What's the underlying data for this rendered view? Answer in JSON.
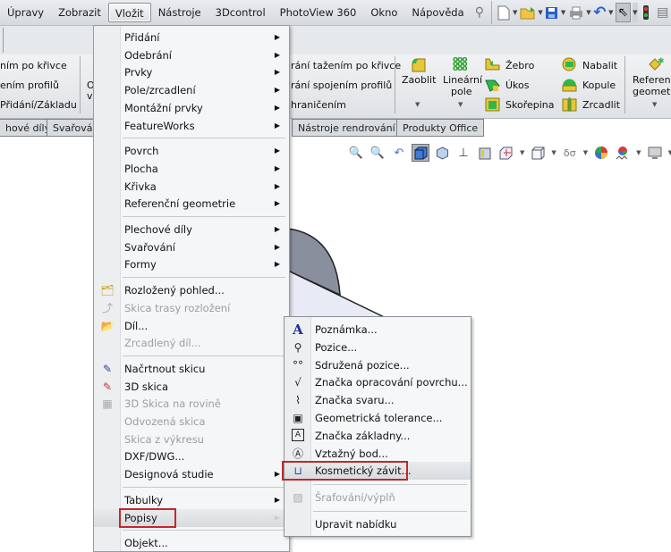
{
  "menubar": {
    "items": [
      "Úpravy",
      "Zobrazit",
      "Vložit",
      "Nástroje",
      "3Dcontrol",
      "PhotoView 360",
      "Okno",
      "Nápověda"
    ],
    "active": "Vložit",
    "toolbar_icons": [
      "pin-icon",
      "new-document-icon",
      "open-folder-icon",
      "save-icon",
      "print-icon",
      "undo-icon",
      "select-pointer-icon",
      "traffic-light-icon"
    ]
  },
  "ribbon": {
    "left_items": [
      "ním po křivce",
      "ením profilů",
      "Přidání/Základu"
    ],
    "left_partial": [
      "O",
      "v"
    ],
    "mid_items": [
      "rání tažením po křivce",
      "rání spojením profilů",
      "hraničením"
    ],
    "features": {
      "fillet": "Zaoblit",
      "linear_pattern_line1": "Lineární",
      "linear_pattern_line2": "pole",
      "rib": "Žebro",
      "draft": "Úkos",
      "shell": "Skořepina",
      "wrap": "Nabalit",
      "dome": "Kopule",
      "mirror": "Zrcadlit",
      "ref_geom_line1": "Referenč",
      "ref_geom_line2": "geometr"
    }
  },
  "tabs": [
    "hové díly",
    "Svařová",
    "Nástroje rendrování",
    "Produkty Office"
  ],
  "view_toolbar_icons": [
    "zoom-to-fit-icon",
    "zoom-area-icon",
    "previous-view-icon",
    "display-style-icon",
    "section-view-icon",
    "view-orientation-icon",
    "hide-show-icon",
    "section-icon",
    "view-cube-icon",
    "glasses-icon",
    "appearance-icon",
    "scene-icon",
    "monitor-icon"
  ],
  "insert_menu": {
    "groups": [
      [
        {
          "label": "Přidání",
          "submenu": true
        },
        {
          "label": "Odebrání",
          "submenu": true
        },
        {
          "label": "Prvky",
          "submenu": true
        },
        {
          "label": "Pole/zrcadlení",
          "submenu": true
        },
        {
          "label": "Montážní prvky",
          "submenu": true
        },
        {
          "label": "FeatureWorks",
          "submenu": true
        }
      ],
      [
        {
          "label": "Povrch",
          "submenu": true
        },
        {
          "label": "Plocha",
          "submenu": true
        },
        {
          "label": "Křivka",
          "submenu": true
        },
        {
          "label": "Referenční geometrie",
          "submenu": true
        }
      ],
      [
        {
          "label": "Plechové díly",
          "submenu": true
        },
        {
          "label": "Svařování",
          "submenu": true
        },
        {
          "label": "Formy",
          "submenu": true
        }
      ],
      [
        {
          "label": "Rozložený pohled...",
          "icon": "exploded-view-icon"
        },
        {
          "label": "Skica trasy rozložení",
          "disabled": true,
          "icon": "explode-line-sketch-icon"
        },
        {
          "label": "Díl...",
          "icon": "part-icon"
        },
        {
          "label": "Zrcadlený díl...",
          "disabled": true
        }
      ],
      [
        {
          "label": "Načrtnout skicu",
          "icon": "sketch-icon"
        },
        {
          "label": "3D skica",
          "icon": "3d-sketch-icon"
        },
        {
          "label": "3D Skica na rovině",
          "disabled": true,
          "icon": "3d-sketch-plane-icon"
        },
        {
          "label": "Odvozená skica",
          "disabled": true
        },
        {
          "label": "Skica z výkresu",
          "disabled": true
        },
        {
          "label": "DXF/DWG..."
        },
        {
          "label": "Designová studie",
          "submenu": true
        }
      ],
      [
        {
          "label": "Tabulky",
          "submenu": true
        },
        {
          "label": "Popisy",
          "submenu": true,
          "highlighted": true
        }
      ],
      [
        {
          "label": "Objekt..."
        }
      ]
    ]
  },
  "annotations_submenu": {
    "items": [
      {
        "label": "Poznámka...",
        "icon": "note-icon"
      },
      {
        "label": "Pozice...",
        "icon": "balloon-icon"
      },
      {
        "label": "Sdružená pozice...",
        "icon": "stacked-balloon-icon"
      },
      {
        "label": "Značka opracování povrchu...",
        "icon": "surface-finish-icon"
      },
      {
        "label": "Značka svaru...",
        "icon": "weld-symbol-icon"
      },
      {
        "label": "Geometrická tolerance...",
        "icon": "geometric-tolerance-icon"
      },
      {
        "label": "Značka základny...",
        "icon": "datum-feature-icon"
      },
      {
        "label": "Vztažný bod...",
        "icon": "datum-target-icon"
      },
      {
        "label": "Kosmetický závit...",
        "icon": "cosmetic-thread-icon",
        "highlighted": true
      },
      {
        "label": "Šrafování/výplň",
        "icon": "hatch-icon",
        "disabled": true
      },
      {
        "label": "Upravit nabídku"
      }
    ]
  },
  "colors": {
    "highlight_box": "#c0282d",
    "menu_bg": "#f5f6f7",
    "disabled_text": "#9a9ea3"
  }
}
